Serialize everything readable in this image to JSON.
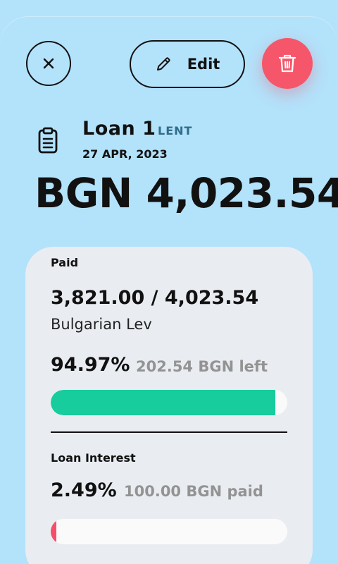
{
  "toolbar": {
    "edit_label": "Edit"
  },
  "loan": {
    "title": "Loan 1",
    "type": "LENT",
    "date": "27 APR, 2023",
    "amount": "BGN 4,023.54"
  },
  "paid": {
    "label": "Paid",
    "value": "3,821.00 / 4,023.54",
    "currency_name": "Bulgarian Lev",
    "percent_label": "94.97%",
    "note": "202.54 BGN left",
    "progress_fraction": 0.9497
  },
  "interest": {
    "label": "Loan Interest",
    "percent_label": "2.49%",
    "note": "100.00 BGN paid",
    "progress_fraction": 0.0249
  },
  "colors": {
    "background": "#b3e2fb",
    "card": "#e9edf1",
    "delete": "#f6566a",
    "paid_bar": "#17cc9d",
    "interest_bar": "#f44e6a",
    "type_tag": "#2f6c8a",
    "muted_note": "#939393"
  },
  "icons": {
    "close": "close-icon",
    "edit": "pencil-icon",
    "delete": "trash-icon",
    "loan": "clipboard-icon"
  }
}
